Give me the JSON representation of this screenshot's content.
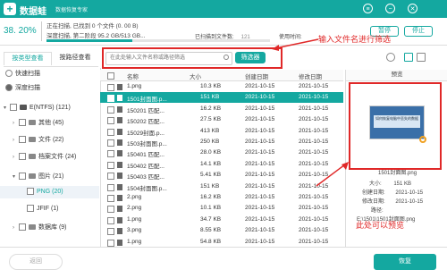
{
  "app": {
    "name": "数据蛙",
    "subtitle": "数据恢复专家",
    "logo": "+"
  },
  "window": {
    "menu_icon": "≡",
    "minimize_icon": "−",
    "close_icon": "✕"
  },
  "scan": {
    "percent_label": "38. 20%",
    "progress": 0.382,
    "line1": "正在扫描, 已找到 0 个文件 (0. 00 B)",
    "line2": "深度扫描, 第二阶段 95.2 GB/513 GB...",
    "found_label": "已扫描到文件数:",
    "found_count": "121",
    "usage_label": "使用时间:",
    "pause_button": "暂停",
    "stop_button": "停止"
  },
  "tabs": [
    {
      "label": "按类型查看"
    },
    {
      "label": "按路径查看"
    }
  ],
  "tree": [
    {
      "label": "快速扫描",
      "arrow": "",
      "icon": "circle"
    },
    {
      "label": "深度扫描",
      "arrow": "",
      "icon": "circle"
    },
    {
      "label": "E(NTFS) (121)",
      "arrow": "▾",
      "icon": "drive"
    },
    {
      "label": "其他 (45)",
      "arrow": "›",
      "icon": "folder"
    },
    {
      "label": "文件 (22)",
      "arrow": "›",
      "icon": "folder"
    },
    {
      "label": "档案文件 (24)",
      "arrow": "›",
      "icon": "folder"
    },
    {
      "label": "图片 (21)",
      "arrow": "▾",
      "icon": "folder"
    },
    {
      "label": "PNG (20)",
      "arrow": "",
      "icon": ""
    },
    {
      "label": "JFIF (1)",
      "arrow": "",
      "icon": ""
    },
    {
      "label": "数据库 (9)",
      "arrow": "›",
      "icon": "folder"
    }
  ],
  "search": {
    "placeholder": "在此处输入文件名称或路径筛选",
    "filter_button": "筛选器"
  },
  "annotations": {
    "search_hint": "输入文件名进行筛选",
    "preview_hint": "此处可以预览"
  },
  "table": {
    "headers": [
      "名称",
      "大小",
      "创建日期",
      "修改日期"
    ],
    "rows": [
      {
        "name": "1.png",
        "size": "10.3 KB",
        "created": "2021-10-15",
        "modified": "2021-10-15",
        "selected": false
      },
      {
        "name": "1501封面图.p...",
        "size": "151 KB",
        "created": "2021-10-15",
        "modified": "2021-10-15",
        "selected": true
      },
      {
        "name": "150201 匹配...",
        "size": "16.2 KB",
        "created": "2021-10-15",
        "modified": "2021-10-15",
        "selected": false
      },
      {
        "name": "150202 匹配...",
        "size": "27.5 KB",
        "created": "2021-10-15",
        "modified": "2021-10-15",
        "selected": false
      },
      {
        "name": "15029封面.p...",
        "size": "413 KB",
        "created": "2021-10-15",
        "modified": "2021-10-15",
        "selected": false
      },
      {
        "name": "1503封面图.p...",
        "size": "250 KB",
        "created": "2021-10-15",
        "modified": "2021-10-15",
        "selected": false
      },
      {
        "name": "150401 匹配...",
        "size": "28.0 KB",
        "created": "2021-10-15",
        "modified": "2021-10-15",
        "selected": false
      },
      {
        "name": "150402 匹配...",
        "size": "14.1 KB",
        "created": "2021-10-15",
        "modified": "2021-10-15",
        "selected": false
      },
      {
        "name": "150403 匹配...",
        "size": "5.41 KB",
        "created": "2021-10-15",
        "modified": "2021-10-15",
        "selected": false
      },
      {
        "name": "1504封面图.p...",
        "size": "151 KB",
        "created": "2021-10-15",
        "modified": "2021-10-15",
        "selected": false
      },
      {
        "name": "2.png",
        "size": "16.2 KB",
        "created": "2021-10-15",
        "modified": "2021-10-15",
        "selected": false
      },
      {
        "name": "2.png",
        "size": "10.1 KB",
        "created": "2021-10-15",
        "modified": "2021-10-15",
        "selected": false
      },
      {
        "name": "1.png",
        "size": "34.7 KB",
        "created": "2021-10-15",
        "modified": "2021-10-15",
        "selected": false
      },
      {
        "name": "3.png",
        "size": "8.55 KB",
        "created": "2021-10-15",
        "modified": "2021-10-15",
        "selected": false
      },
      {
        "name": "1.png",
        "size": "54.8 KB",
        "created": "2021-10-15",
        "modified": "2021-10-15",
        "selected": false
      }
    ]
  },
  "preview": {
    "title": "预览",
    "thumb_text": "如何恢复电脑中丢失的数据",
    "filename": "1501封面图.png",
    "size_label": "大小:",
    "size": "151 KB",
    "created_label": "创建日期:",
    "created": "2021-10-15",
    "modified_label": "修改日期:",
    "modified": "2021-10-15",
    "path_label": "路径:",
    "path": "E:\\1501\\1501封面图.png"
  },
  "bottom": {
    "back_button": "返回",
    "recover_button": "恢复"
  },
  "colors": {
    "accent": "#14a8a0",
    "annotation": "#e02828"
  }
}
